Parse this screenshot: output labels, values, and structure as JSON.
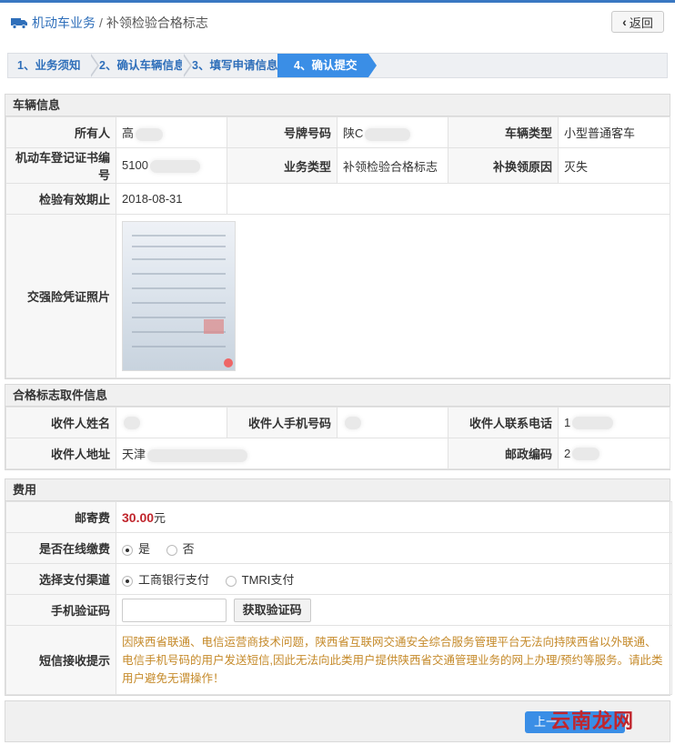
{
  "breadcrumb": {
    "section": "机动车业务",
    "separator": "/",
    "current": "补领检验合格标志"
  },
  "back_button": "返回",
  "steps": [
    "1、业务须知",
    "2、确认车辆信息",
    "3、填写申请信息",
    "4、确认提交"
  ],
  "vehicle": {
    "title": "车辆信息",
    "owner_label": "所有人",
    "owner_value": "高",
    "plate_label": "号牌号码",
    "plate_value": "陕C",
    "type_label": "车辆类型",
    "type_value": "小型普通客车",
    "cert_label": "机动车登记证书编号",
    "cert_value": "5100",
    "biz_label": "业务类型",
    "biz_value": "补领检验合格标志",
    "reason_label": "补换领原因",
    "reason_value": "灭失",
    "valid_label": "检验有效期止",
    "valid_value": "2018-08-31",
    "insurance_label": "交强险凭证照片"
  },
  "pickup": {
    "title": "合格标志取件信息",
    "name_label": "收件人姓名",
    "name_value": "",
    "mobile_label": "收件人手机号码",
    "mobile_value": "",
    "phone_label": "收件人联系电话",
    "phone_value": "1",
    "address_label": "收件人地址",
    "address_value": "天津",
    "zip_label": "邮政编码",
    "zip_value": "2"
  },
  "fee": {
    "title": "费用",
    "postage_label": "邮寄费",
    "postage_amount": "30.00",
    "postage_unit": "元",
    "online_label": "是否在线缴费",
    "online_yes": "是",
    "online_no": "否",
    "channel_label": "选择支付渠道",
    "channel_icbc": "工商银行支付",
    "channel_tmri": "TMRI支付",
    "code_label": "手机验证码",
    "code_button": "获取验证码",
    "sms_label": "短信接收提示",
    "sms_notice": "因陕西省联通、电信运营商技术问题，陕西省互联网交通安全综合服务管理平台无法向持陕西省以外联通、电信手机号码的用户发送短信,因此无法向此类用户提供陕西省交通管理业务的网上办理/预约等服务。请此类用户避免无谓操作！"
  },
  "footer": {
    "prev_button": "上一",
    "watermark": "云南龙网"
  },
  "colors": {
    "accent": "#3a8ee6",
    "fee_red": "#c0262d",
    "notice": "#c58a2a"
  }
}
